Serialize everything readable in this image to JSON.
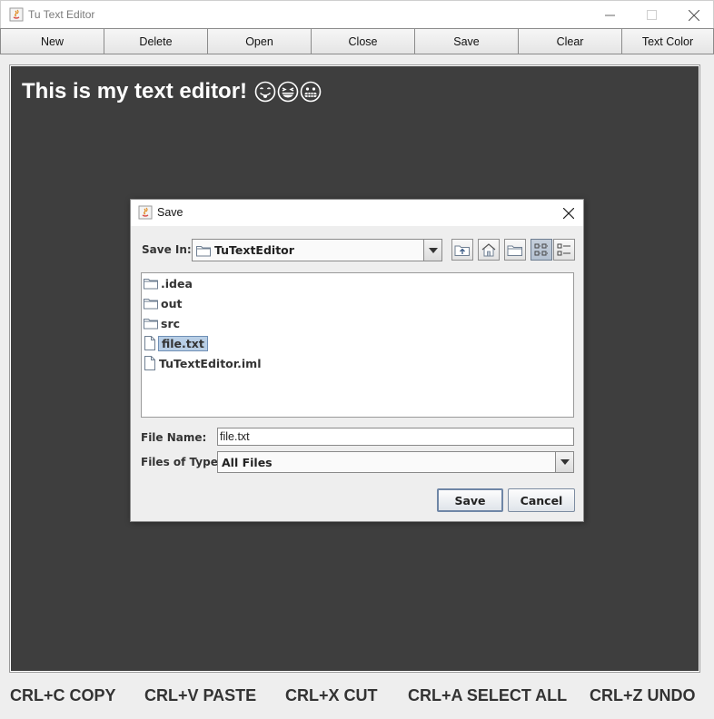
{
  "window": {
    "title": "Tu Text Editor"
  },
  "toolbar": {
    "buttons": [
      "New",
      "Delete",
      "Open",
      "Close",
      "Save",
      "Clear",
      "Text Color"
    ]
  },
  "editor": {
    "text": "This is my text editor!",
    "background": "#3e3e3e",
    "text_color": "#ffffff",
    "emojis": [
      "smiling-tongue-emoji",
      "grinning-squint-emoji",
      "grimacing-emoji"
    ]
  },
  "shortcuts": [
    "CRL+C COPY",
    "CRL+V PASTE",
    "CRL+X CUT",
    "CRL+A SELECT ALL",
    "CRL+Z UNDO"
  ],
  "save_dialog": {
    "title": "Save",
    "save_in_label": "Save In:",
    "save_in_value": "TuTextEditor",
    "toolbar_icons": [
      "up-one-level-icon",
      "home-icon",
      "new-folder-icon",
      "list-view-icon",
      "details-view-icon"
    ],
    "files": [
      {
        "name": ".idea",
        "type": "folder",
        "selected": false
      },
      {
        "name": "out",
        "type": "folder",
        "selected": false
      },
      {
        "name": "src",
        "type": "folder",
        "selected": false
      },
      {
        "name": "file.txt",
        "type": "file",
        "selected": true
      },
      {
        "name": "TuTextEditor.iml",
        "type": "file",
        "selected": false
      }
    ],
    "file_name_label": "File Name:",
    "file_name_value": "file.txt",
    "file_type_label": "Files of Type:",
    "file_type_value": "All Files",
    "save_button": "Save",
    "cancel_button": "Cancel"
  }
}
